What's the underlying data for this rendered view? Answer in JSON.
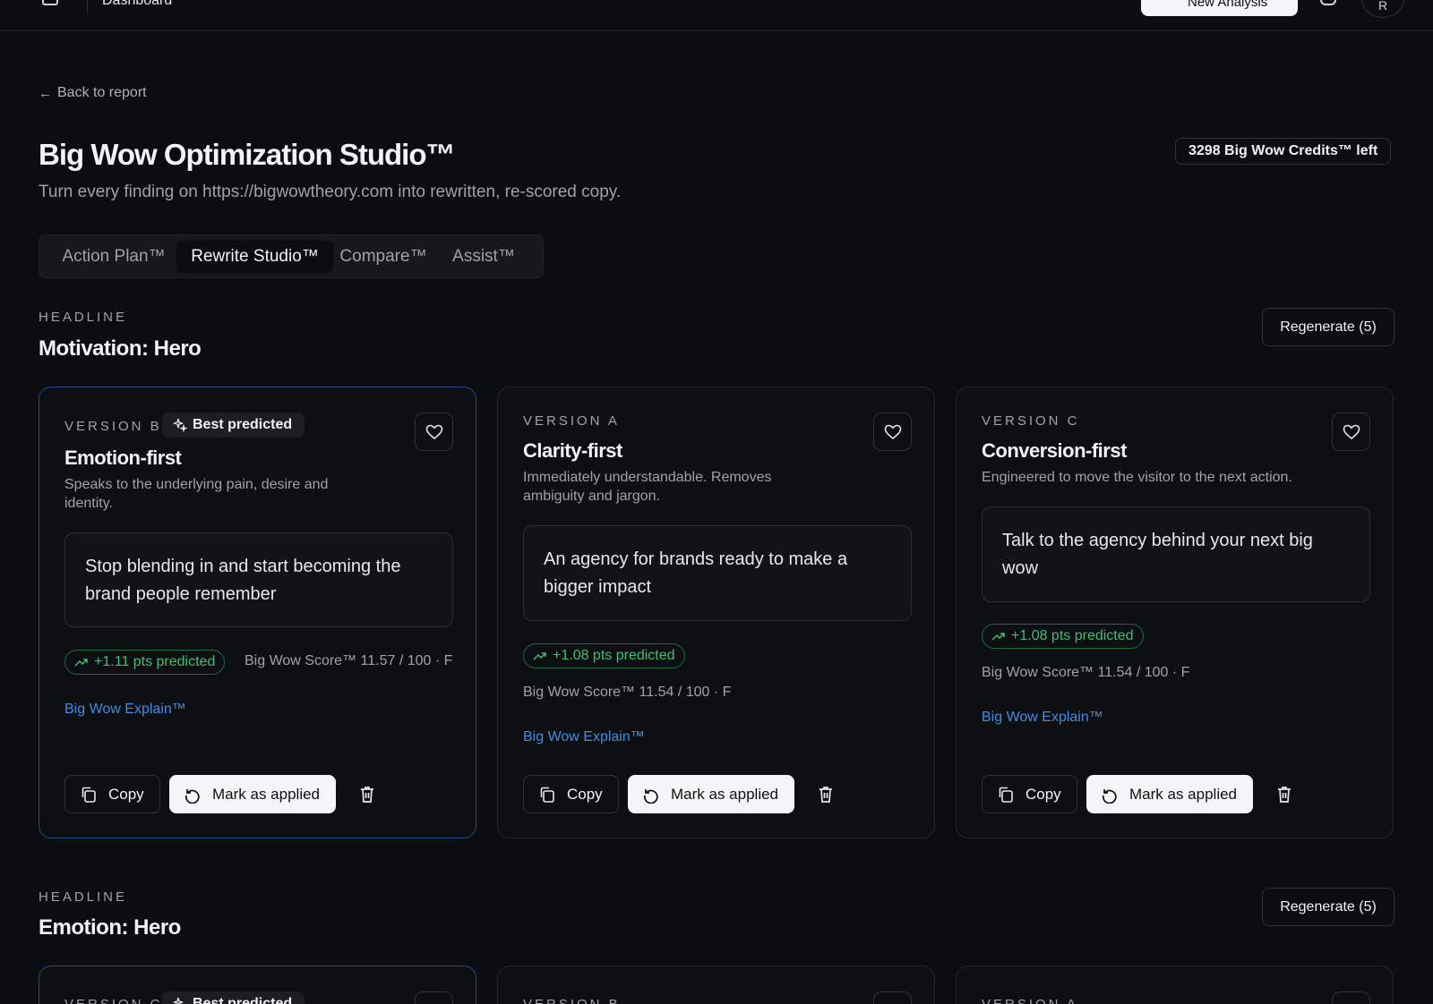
{
  "topbar": {
    "breadcrumb": "Dashboard",
    "new_button": "New Analysis",
    "avatar_initial": "R"
  },
  "back_link": "Back to report",
  "page": {
    "title": "Big Wow Optimization Studio™",
    "subtitle": "Turn every finding on https://bigwowtheory.com into rewritten, re-scored copy.",
    "credits": "3298 Big Wow Credits™ left"
  },
  "tabs": [
    {
      "label": "Action Plan™",
      "active": false
    },
    {
      "label": "Rewrite Studio™",
      "active": true
    },
    {
      "label": "Compare™",
      "active": false
    },
    {
      "label": "Assist™",
      "active": false
    }
  ],
  "sections": [
    {
      "label": "HEADLINE",
      "title": "Motivation: Hero",
      "regenerate": "Regenerate (5)",
      "cards": [
        {
          "version": "VERSION B",
          "badge": "Best predicted",
          "title": "Emotion-first",
          "description": "Speaks to the underlying pain, desire and identity.",
          "copy": "Stop blending in and start becoming the brand people remember",
          "pts": "+1.11 pts predicted",
          "score": "Big Wow Score™ 11.57 / 100 · F",
          "explain": "Big Wow Explain™",
          "copy_btn": "Copy",
          "applied_btn": "Mark as applied"
        },
        {
          "version": "VERSION A",
          "title": "Clarity-first",
          "description": "Immediately understandable. Removes ambiguity and jargon.",
          "copy": "An agency for brands ready to make a bigger impact",
          "pts": "+1.08 pts predicted",
          "score": "Big Wow Score™ 11.54 / 100 · F",
          "explain": "Big Wow Explain™",
          "copy_btn": "Copy",
          "applied_btn": "Mark as applied"
        },
        {
          "version": "VERSION C",
          "title": "Conversion-first",
          "description": "Engineered to move the visitor to the next action.",
          "copy": "Talk to the agency behind your next big wow",
          "pts": "+1.08 pts predicted",
          "score": "Big Wow Score™ 11.54 / 100 · F",
          "explain": "Big Wow Explain™",
          "copy_btn": "Copy",
          "applied_btn": "Mark as applied"
        }
      ]
    },
    {
      "label": "HEADLINE",
      "title": "Emotion: Hero",
      "regenerate": "Regenerate (5)",
      "cards": [
        {
          "version": "VERSION C",
          "badge": "Best predicted"
        },
        {
          "version": "VERSION B"
        },
        {
          "version": "VERSION A"
        }
      ]
    }
  ],
  "colors": {
    "background": "#0b0d11",
    "accent_blue": "#3d8ee6",
    "positive_green": "#3fbf72",
    "best_border": "#1f4f86"
  }
}
